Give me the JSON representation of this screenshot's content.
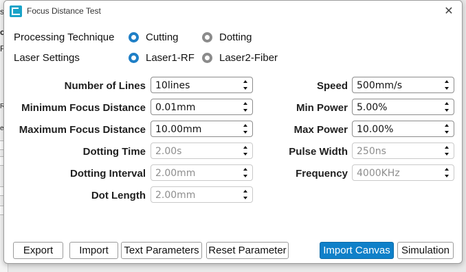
{
  "background_app": {
    "fragments": [
      "su",
      "ct",
      "Fil",
      "R",
      "es",
      "ar",
      "ar",
      "ar"
    ]
  },
  "dialog": {
    "title": "Focus Distance Test",
    "close_glyph": "✕",
    "icon": "app-logo-icon"
  },
  "processing_technique": {
    "label": "Processing Technique",
    "options": [
      {
        "label": "Cutting",
        "selected": true
      },
      {
        "label": "Dotting",
        "selected": false
      }
    ]
  },
  "laser_settings": {
    "label": "Laser Settings",
    "options": [
      {
        "label": "Laser1-RF",
        "selected": true
      },
      {
        "label": "Laser2-Fiber",
        "selected": false
      }
    ]
  },
  "left_fields": [
    {
      "label": "Number of Lines",
      "value": "10lines",
      "enabled": true
    },
    {
      "label": "Minimum Focus Distance",
      "value": "0.01mm",
      "enabled": true
    },
    {
      "label": "Maximum Focus Distance",
      "value": "10.00mm",
      "enabled": true
    },
    {
      "label": "Dotting Time",
      "value": "2.00s",
      "enabled": false
    },
    {
      "label": "Dotting Interval",
      "value": "2.00mm",
      "enabled": false
    },
    {
      "label": "Dot Length",
      "value": "2.00mm",
      "enabled": false
    }
  ],
  "right_fields": [
    {
      "label": "Speed",
      "value": "500mm/s",
      "enabled": true
    },
    {
      "label": "Min Power",
      "value": "5.00%",
      "enabled": true
    },
    {
      "label": "Max Power",
      "value": "10.00%",
      "enabled": true
    },
    {
      "label": "Pulse Width",
      "value": "250ns",
      "enabled": false
    },
    {
      "label": "Frequency",
      "value": "4000KHz",
      "enabled": false
    }
  ],
  "buttons": {
    "export": "Export",
    "import": "Import",
    "text_parameters": "Text Parameters",
    "reset_parameter": "Reset Parameter",
    "import_canvas": "Import Canvas",
    "simulation": "Simulation"
  },
  "colors": {
    "accent": "#0f80c9",
    "radio_selected": "#1f7fc6",
    "radio_unselected": "#8b8b8b"
  }
}
